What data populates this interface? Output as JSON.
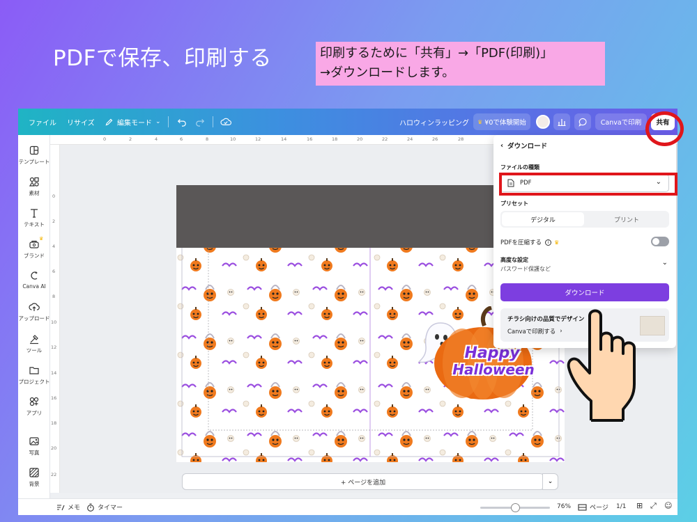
{
  "slide": {
    "title": "PDFで保存、印刷する",
    "callout_line1": "印刷するために「共有」→「PDF(印刷)」",
    "callout_line2": "→ダウンロードします。"
  },
  "topbar": {
    "file": "ファイル",
    "resize": "リサイズ",
    "edit_mode": "編集モード",
    "doc_title": "ハロウィンラッピング",
    "trial": "¥0で体験開始",
    "print": "Canvaで印刷",
    "share": "共有"
  },
  "sidebar": {
    "items": [
      {
        "label": "テンプレート",
        "icon": "template-icon"
      },
      {
        "label": "素材",
        "icon": "elements-icon"
      },
      {
        "label": "テキスト",
        "icon": "text-icon"
      },
      {
        "label": "ブランド",
        "icon": "brand-icon"
      },
      {
        "label": "Canva AI",
        "icon": "canva-ai-icon"
      },
      {
        "label": "アップロード",
        "icon": "upload-icon"
      },
      {
        "label": "ツール",
        "icon": "tools-icon"
      },
      {
        "label": "プロジェクト",
        "icon": "folder-icon"
      },
      {
        "label": "アプリ",
        "icon": "apps-icon"
      },
      {
        "label": "写真",
        "icon": "photo-icon"
      },
      {
        "label": "背景",
        "icon": "background-icon"
      }
    ]
  },
  "ruler": {
    "top": [
      "0",
      "2",
      "4",
      "6",
      "8",
      "10",
      "12",
      "14",
      "16",
      "18",
      "20",
      "22",
      "24",
      "26",
      "28"
    ],
    "left": [
      "0",
      "2",
      "4",
      "6",
      "8",
      "10",
      "12",
      "14",
      "16",
      "18",
      "20",
      "22"
    ]
  },
  "design": {
    "happy": "Happy",
    "halloween": "Halloween"
  },
  "add_page": "+ ページを追加",
  "panel": {
    "back_title": "ダウンロード",
    "file_type_label": "ファイルの種類",
    "file_type_value": "PDF",
    "preset_label": "プリセット",
    "preset_digital": "デジタル",
    "preset_print": "プリント",
    "compress_label": "PDFを圧縮する",
    "advanced_label": "高度な設定",
    "advanced_sub": "パスワード保護など",
    "download_button": "ダウンロード",
    "promo_title": "チラシ向けの品質でデザイン",
    "promo_link": "Canvaで印刷する"
  },
  "bottom": {
    "memo": "メモ",
    "timer": "タイマー",
    "zoom_pct": "76%",
    "zoom_value": 0.76,
    "pages": "ページ",
    "page_count": "1/1"
  },
  "colors": {
    "accent": "#7d3ee0",
    "highlight_red": "#e0161b",
    "callout_pink": "#f9a8e6"
  }
}
